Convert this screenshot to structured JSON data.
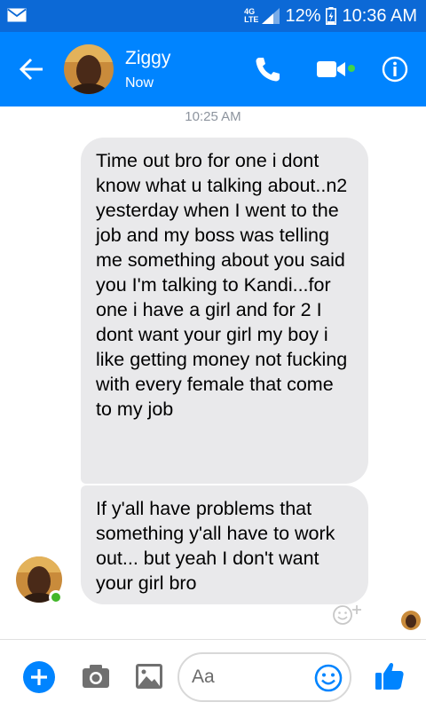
{
  "status_bar": {
    "network": "4G LTE",
    "battery": "12%",
    "time": "10:36 AM"
  },
  "header": {
    "contact_name": "Ziggy",
    "contact_status": "Now"
  },
  "chat": {
    "timestamp": "10:25 AM",
    "messages": [
      {
        "sender": "Ziggy",
        "text": "Time out bro for one i dont know what u talking about..n2 yesterday when I went to the job and my boss was telling me something about you said you I'm talking to Kandi...for one i have a girl and for 2 I dont want your girl my boy i like getting money not fucking with every female that come to my job"
      },
      {
        "sender": "Ziggy",
        "text": "If y'all have problems that something y'all have to work out... but yeah I don't want your girl bro"
      }
    ]
  },
  "composer": {
    "placeholder": "Aa"
  },
  "colors": {
    "accent": "#0084ff",
    "status_bar": "#0c69d6",
    "bubble": "#e9e9eb",
    "online": "#42b72a"
  },
  "icons": [
    "envelope-icon",
    "signal-icon",
    "battery-icon",
    "back-arrow-icon",
    "phone-icon",
    "video-camera-icon",
    "info-icon",
    "add-reaction-icon",
    "plus-icon",
    "camera-icon",
    "gallery-icon",
    "emoji-icon",
    "thumbs-up-icon"
  ]
}
